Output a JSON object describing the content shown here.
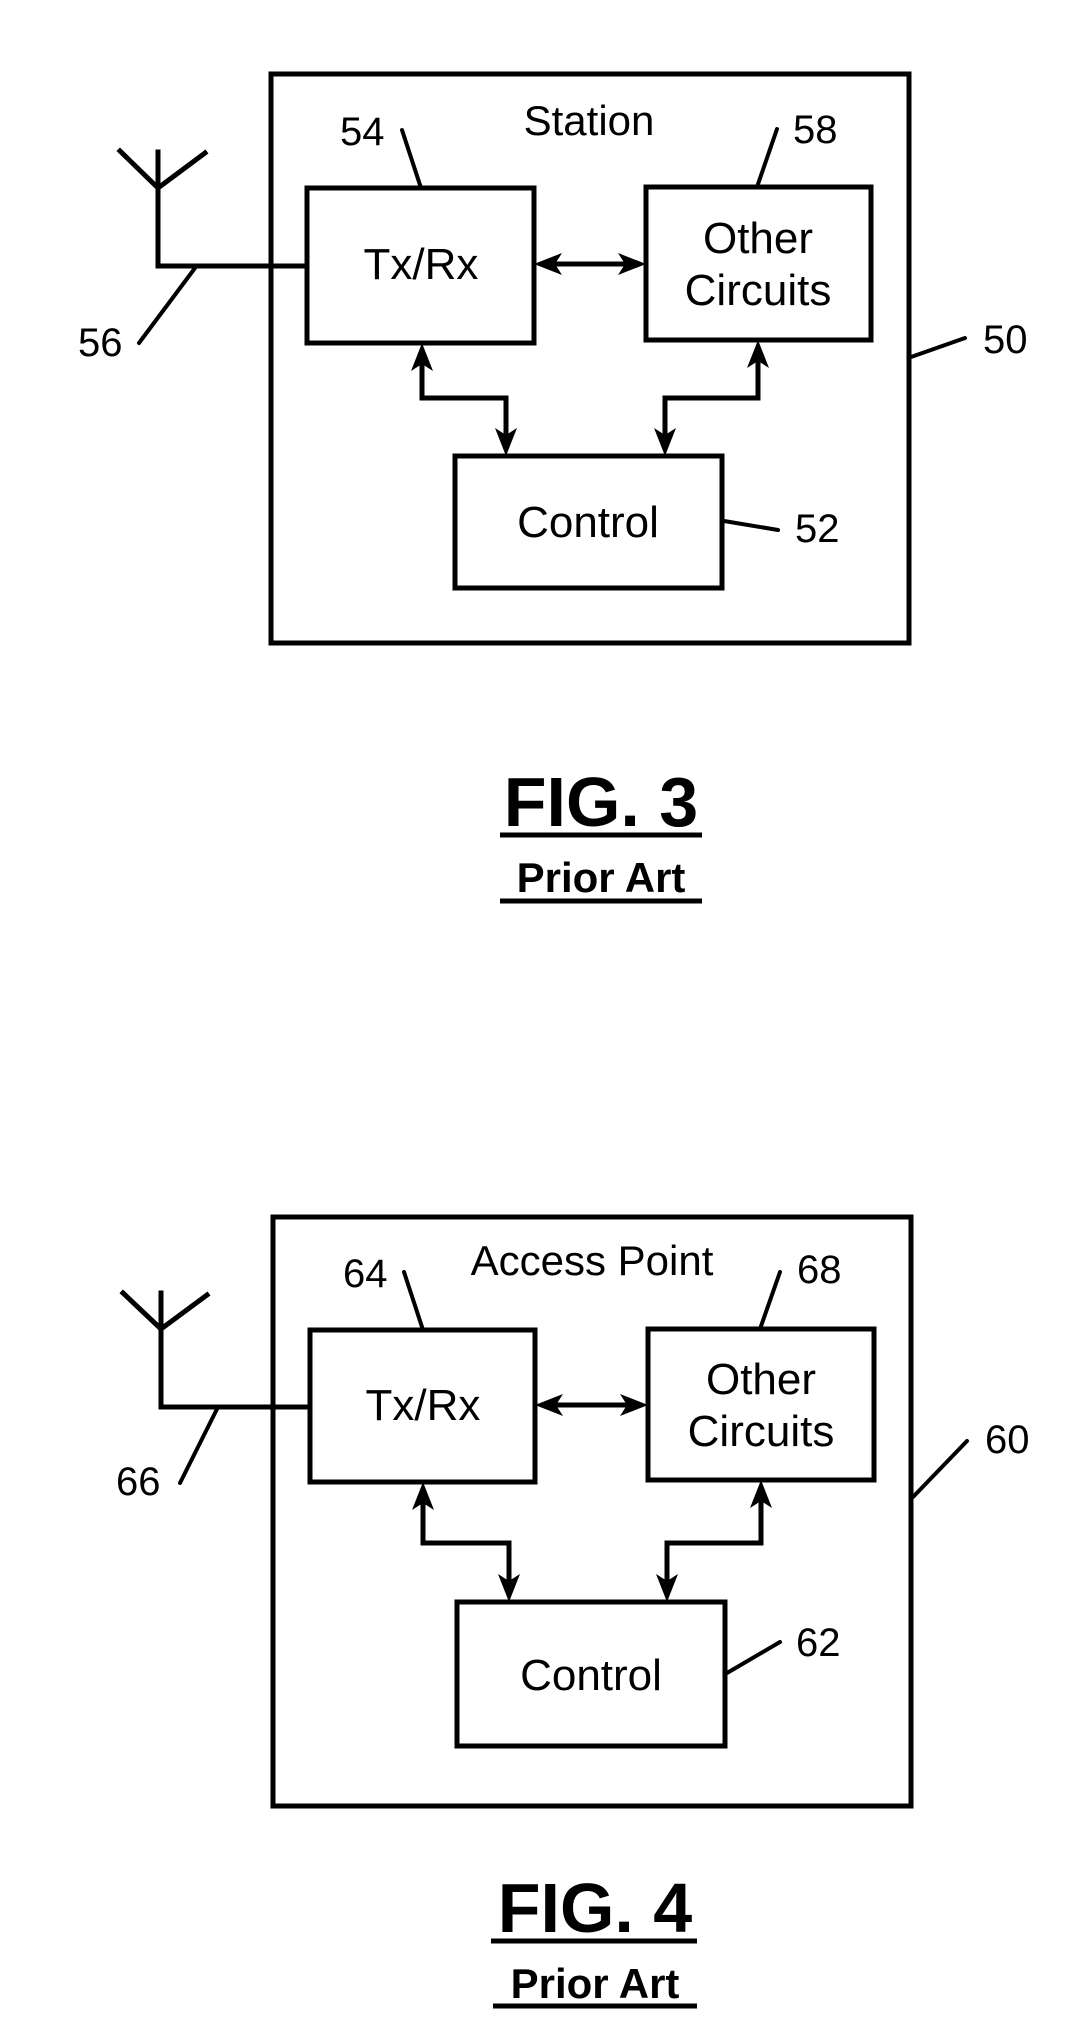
{
  "figures": [
    {
      "id": "fig3",
      "caption": "FIG. 3",
      "subcaption": "Prior Art",
      "container": {
        "title": "Station",
        "ref": "50"
      },
      "blocks": {
        "txrx": {
          "label": "Tx/Rx",
          "ref": "54"
        },
        "other": {
          "line1": "Other",
          "line2": "Circuits",
          "ref": "58"
        },
        "control": {
          "label": "Control",
          "ref": "52"
        }
      },
      "antenna": {
        "ref": "56"
      }
    },
    {
      "id": "fig4",
      "caption": "FIG. 4",
      "subcaption": "Prior Art",
      "container": {
        "title": "Access Point",
        "ref": "60"
      },
      "blocks": {
        "txrx": {
          "label": "Tx/Rx",
          "ref": "64"
        },
        "other": {
          "line1": "Other",
          "line2": "Circuits",
          "ref": "68"
        },
        "control": {
          "label": "Control",
          "ref": "62"
        }
      },
      "antenna": {
        "ref": "66"
      }
    }
  ]
}
